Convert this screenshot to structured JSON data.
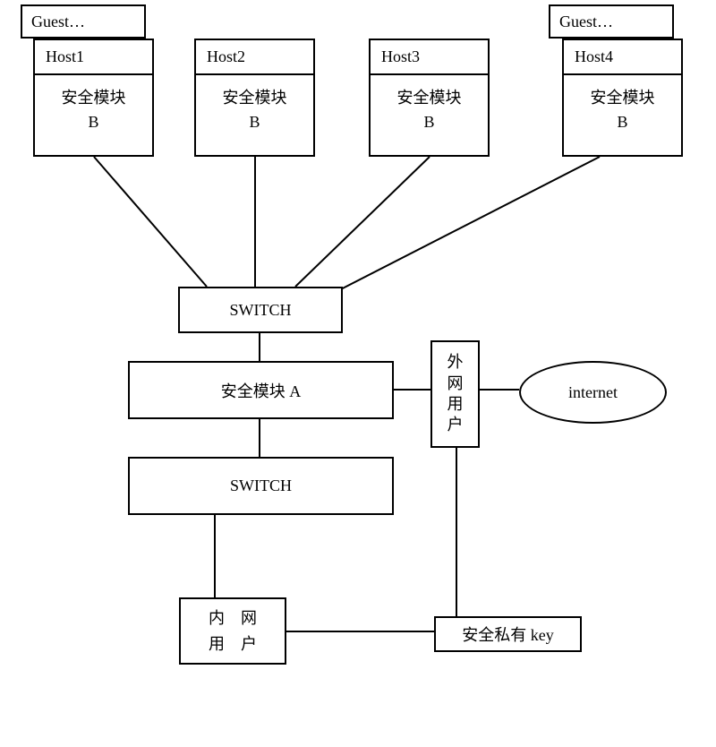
{
  "guests": {
    "guest1": "Guest…",
    "guest2": "Guest…"
  },
  "hosts": {
    "host1": {
      "name": "Host1",
      "module": "安全模块\nB"
    },
    "host2": {
      "name": "Host2",
      "module": "安全模块\nB"
    },
    "host3": {
      "name": "Host3",
      "module": "安全模块\nB"
    },
    "host4": {
      "name": "Host4",
      "module": "安全模块\nB"
    }
  },
  "switch1": "SWITCH",
  "securityModuleA": "安全模块 A",
  "switch2": "SWITCH",
  "externalUser": "外\n网\n用\n户",
  "internet": "internet",
  "internalUser": "内　网\n用　户",
  "privateKey": "安全私有 key"
}
